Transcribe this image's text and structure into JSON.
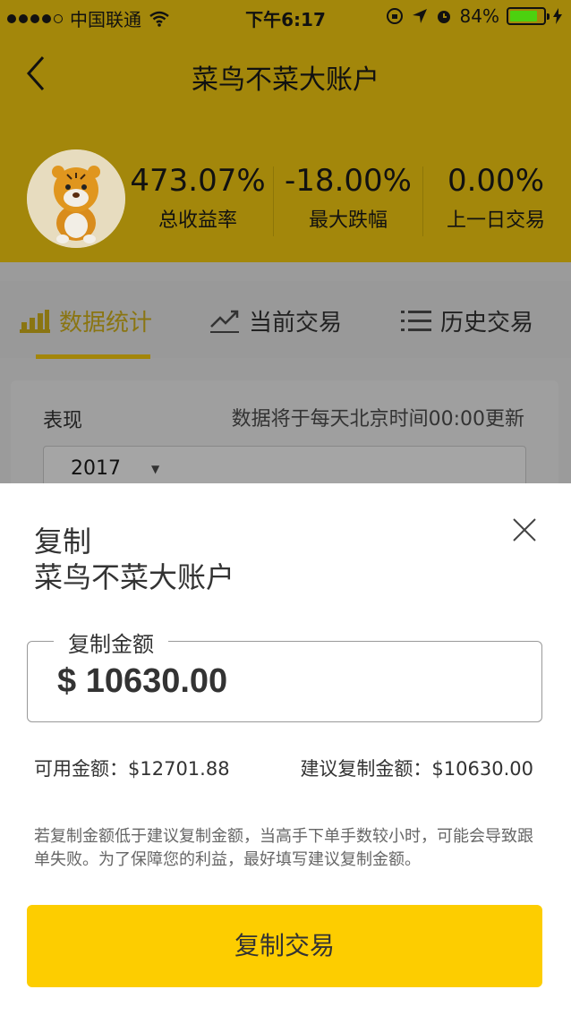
{
  "status_bar": {
    "carrier": "中国联通",
    "time": "下午6:17",
    "battery_percent": "84%",
    "battery_level": 0.84
  },
  "header": {
    "title": "菜鸟不菜大账户",
    "stats": [
      {
        "value": "473.07%",
        "label": "总收益率"
      },
      {
        "value": "-18.00%",
        "label": "最大跌幅"
      },
      {
        "value": "0.00%",
        "label": "上一日交易"
      }
    ]
  },
  "tabs": [
    {
      "label": "数据统计",
      "icon": "bar-chart-icon"
    },
    {
      "label": "当前交易",
      "icon": "trend-line-icon"
    },
    {
      "label": "历史交易",
      "icon": "list-icon"
    }
  ],
  "card": {
    "label": "表现",
    "note": "数据将于每天北京时间00:00更新",
    "year": "2017"
  },
  "modal": {
    "title_line1": "复制",
    "title_line2": "菜鸟不菜大账户",
    "amount_legend": "复制金额",
    "amount_value": "$ 10630.00",
    "available": "可用金额：$12701.88",
    "suggested": "建议复制金额：$10630.00",
    "hint": "若复制金额低于建议复制金额，当高手下单手数较小时，可能会导致跟单失败。为了保障您的利益，最好填写建议复制金额。",
    "cta": "复制交易"
  },
  "colors": {
    "accent": "#fdcd00",
    "header_dimmed": "#a3870b",
    "battery_fill": "#4cd10f"
  }
}
